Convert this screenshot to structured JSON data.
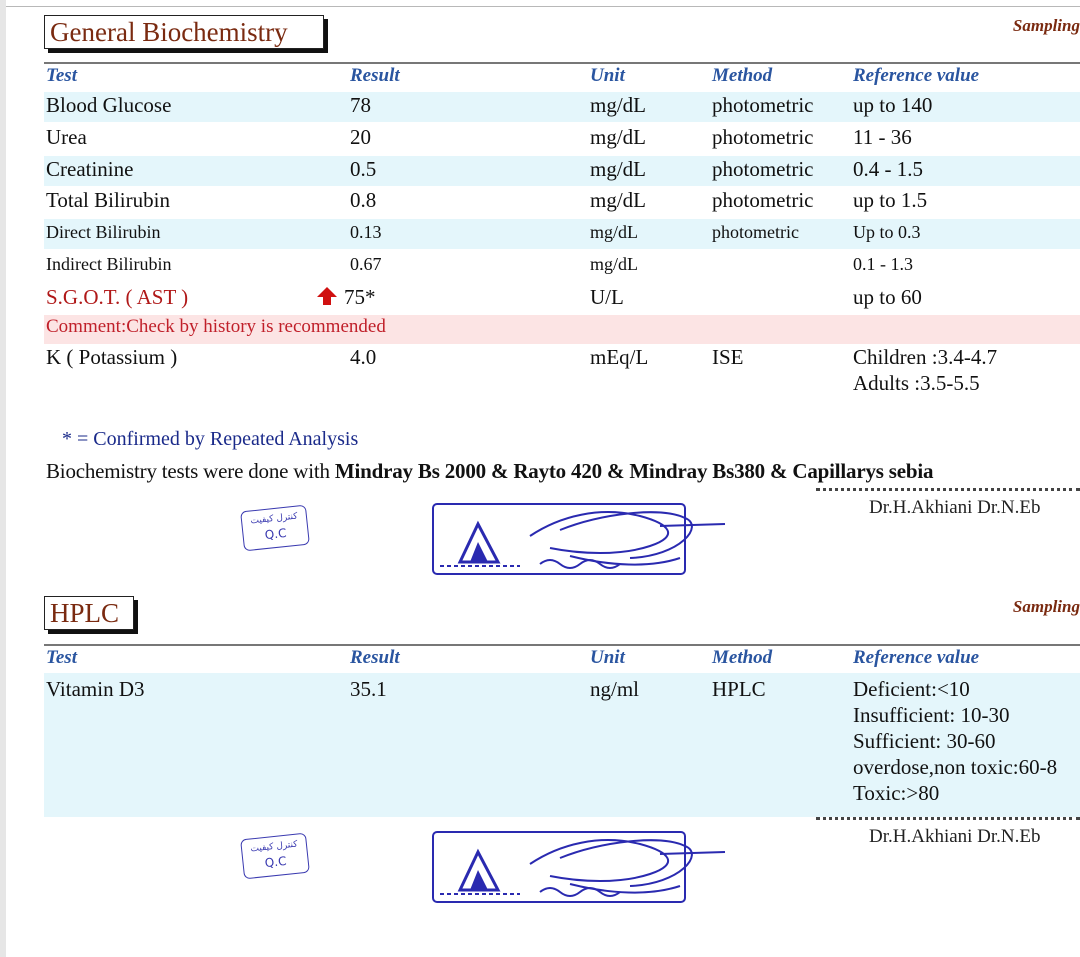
{
  "sections": [
    {
      "title": "General Biochemistry",
      "sampling": "Sampling",
      "headers": {
        "test": "Test",
        "result": "Result",
        "unit": "Unit",
        "method": "Method",
        "ref": "Reference value"
      },
      "rows": [
        {
          "test": "Blood Glucose",
          "result": "78",
          "unit": "mg/dL",
          "method": "photometric",
          "ref": "up to 140"
        },
        {
          "test": "Urea",
          "result": "20",
          "unit": "mg/dL",
          "method": "photometric",
          "ref": "11 - 36"
        },
        {
          "test": "Creatinine",
          "result": "0.5",
          "unit": "mg/dL",
          "method": "photometric",
          "ref": "0.4 - 1.5"
        },
        {
          "test": "Total Bilirubin",
          "result": "0.8",
          "unit": "mg/dL",
          "method": "photometric",
          "ref": "up to 1.5"
        },
        {
          "test": "Direct Bilirubin",
          "result": "0.13",
          "unit": "mg/dL",
          "method": "photometric",
          "ref": "Up to 0.3"
        },
        {
          "test": "Indirect Bilirubin",
          "result": "0.67",
          "unit": "mg/dL",
          "method": "",
          "ref": "0.1 - 1.3"
        },
        {
          "test": "S.G.O.T. ( AST )",
          "result": "75*",
          "unit": "U/L",
          "method": "",
          "ref": "up to 60",
          "flag": "high-arrow-icon"
        },
        {
          "comment": "Comment:Check by history is recommended"
        },
        {
          "test": "K ( Potassium )",
          "result": "4.0",
          "unit": "mEq/L",
          "method": "ISE",
          "ref": "Children :3.4-4.7",
          "ref2": "Adults :3.5-5.5"
        }
      ],
      "footnote": "* = Confirmed by Repeated Analysis",
      "instrument_prefix": "Biochemistry tests were done with ",
      "instrument_names": "Mindray Bs 2000 & Rayto 420 & Mindray Bs380 & Capillarys sebia",
      "doctors": "Dr.H.Akhiani   Dr.N.Eb",
      "qc_stamp": {
        "fa": "کنترل کیفیت",
        "en": "Q.C"
      }
    },
    {
      "title": "HPLC",
      "sampling": "Sampling",
      "headers": {
        "test": "Test",
        "result": "Result",
        "unit": "Unit",
        "method": "Method",
        "ref": "Reference value"
      },
      "rows": [
        {
          "test": "Vitamin D3",
          "result": "35.1",
          "unit": "ng/ml",
          "method": "HPLC",
          "ref_lines": [
            "Deficient:<10",
            "Insufficient: 10-30",
            "Sufficient: 30-60",
            "overdose,non toxic:60-8",
            "Toxic:>80"
          ]
        }
      ],
      "doctors": "Dr.H.Akhiani   Dr.N.Eb",
      "qc_stamp": {
        "fa": "کنترل کیفیت",
        "en": "Q.C"
      }
    }
  ],
  "colors": {
    "title": "#7a2a10",
    "header": "#2a55a0",
    "shade": "#e4f6fb",
    "comment_bg": "#fce4e4",
    "comment_text": "#c0202a",
    "flag": "#d01010",
    "stamp": "#3a3ab0"
  }
}
